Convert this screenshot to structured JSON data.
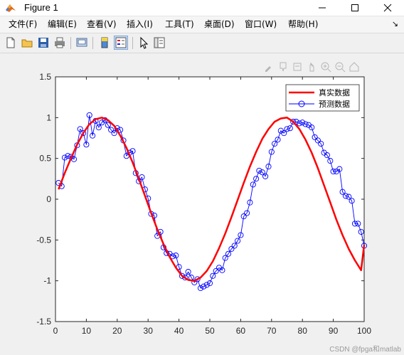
{
  "window": {
    "title": "Figure 1"
  },
  "menu": [
    "文件(F)",
    "编辑(E)",
    "查看(V)",
    "插入(I)",
    "工具(T)",
    "桌面(D)",
    "窗口(W)",
    "帮助(H)"
  ],
  "menu_arrow": "↘",
  "watermark": "CSDN @fpga和matlab",
  "chart_data": {
    "type": "line",
    "xlim": [
      0,
      100
    ],
    "ylim": [
      -1.5,
      1.5
    ],
    "xticks": [
      0,
      10,
      20,
      30,
      40,
      50,
      60,
      70,
      80,
      90,
      100
    ],
    "yticks": [
      1.5,
      1,
      0.5,
      0,
      -0.5,
      -1,
      -1.5
    ],
    "xtick_labels": [
      "0",
      "10",
      "20",
      "30",
      "40",
      "50",
      "60",
      "70",
      "80",
      "90",
      "100"
    ],
    "ytick_labels": [
      "1.5",
      "1",
      "0.5",
      "0",
      "-0.5",
      "-1",
      "-1.5"
    ],
    "grid": false,
    "legend_position": "top-right",
    "series": [
      {
        "name": "真实数据",
        "color": "#ff0000",
        "marker": "none",
        "x": [
          1,
          3,
          5,
          7,
          9,
          11,
          13,
          15,
          17,
          19,
          21,
          23,
          25,
          27,
          29,
          31,
          33,
          35,
          37,
          39,
          41,
          43,
          45,
          47,
          49,
          51,
          53,
          55,
          57,
          59,
          61,
          63,
          65,
          67,
          69,
          71,
          73,
          75,
          77,
          79,
          81,
          83,
          85,
          87,
          89,
          91,
          93,
          95,
          97,
          99,
          100
        ],
        "y": [
          0.12,
          0.32,
          0.5,
          0.67,
          0.81,
          0.92,
          0.98,
          1.0,
          0.97,
          0.9,
          0.78,
          0.63,
          0.45,
          0.25,
          0.04,
          -0.17,
          -0.37,
          -0.55,
          -0.71,
          -0.84,
          -0.94,
          -0.99,
          -1.0,
          -0.96,
          -0.88,
          -0.76,
          -0.6,
          -0.42,
          -0.22,
          -0.01,
          0.2,
          0.4,
          0.58,
          0.74,
          0.86,
          0.95,
          0.99,
          1.0,
          0.95,
          0.86,
          0.73,
          0.57,
          0.38,
          0.17,
          -0.04,
          -0.25,
          -0.44,
          -0.61,
          -0.75,
          -0.87,
          -0.56
        ]
      },
      {
        "name": "预测数据",
        "color": "#0000ff",
        "marker": "o",
        "x": [
          1,
          2,
          3,
          4,
          5,
          6,
          7,
          8,
          9,
          10,
          11,
          12,
          13,
          14,
          15,
          16,
          17,
          18,
          19,
          20,
          21,
          22,
          23,
          24,
          25,
          26,
          27,
          28,
          29,
          30,
          31,
          32,
          33,
          34,
          35,
          36,
          37,
          38,
          39,
          40,
          41,
          42,
          43,
          44,
          45,
          46,
          47,
          48,
          49,
          50,
          51,
          52,
          53,
          54,
          55,
          56,
          57,
          58,
          59,
          60,
          61,
          62,
          63,
          64,
          65,
          66,
          67,
          68,
          69,
          70,
          71,
          72,
          73,
          74,
          75,
          76,
          77,
          78,
          79,
          80,
          81,
          82,
          83,
          84,
          85,
          86,
          87,
          88,
          89,
          90,
          91,
          92,
          93,
          94,
          95,
          96,
          97,
          98,
          99,
          100
        ],
        "y": [
          0.2,
          0.16,
          0.51,
          0.53,
          0.52,
          0.49,
          0.66,
          0.86,
          0.81,
          0.67,
          1.03,
          0.78,
          0.96,
          0.88,
          0.94,
          0.97,
          0.91,
          0.85,
          0.81,
          0.87,
          0.85,
          0.72,
          0.53,
          0.57,
          0.59,
          0.32,
          0.22,
          0.27,
          0.12,
          0.01,
          -0.18,
          -0.2,
          -0.45,
          -0.4,
          -0.59,
          -0.66,
          -0.67,
          -0.7,
          -0.69,
          -0.83,
          -0.94,
          -0.96,
          -0.89,
          -0.96,
          -1.02,
          -0.98,
          -1.09,
          -1.07,
          -1.05,
          -1.03,
          -0.94,
          -0.88,
          -0.84,
          -0.87,
          -0.72,
          -0.67,
          -0.61,
          -0.57,
          -0.51,
          -0.44,
          -0.21,
          -0.17,
          -0.04,
          0.18,
          0.25,
          0.35,
          0.33,
          0.28,
          0.4,
          0.58,
          0.68,
          0.73,
          0.84,
          0.81,
          0.86,
          0.87,
          0.95,
          0.95,
          0.93,
          0.94,
          0.92,
          0.91,
          0.88,
          0.76,
          0.72,
          0.68,
          0.57,
          0.54,
          0.47,
          0.34,
          0.34,
          0.37,
          0.09,
          0.04,
          0.03,
          -0.02,
          -0.3,
          -0.3,
          -0.4,
          -0.57
        ]
      }
    ]
  }
}
